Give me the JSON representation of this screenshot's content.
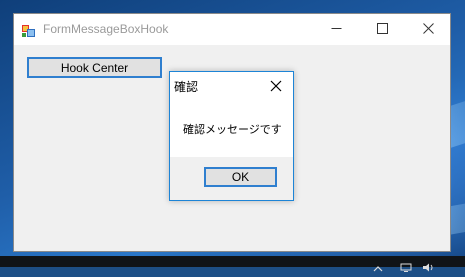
{
  "window": {
    "title": "FormMessageBoxHook"
  },
  "form": {
    "hook_button_label": "Hook Center"
  },
  "dialog": {
    "title": "確認",
    "message": "確認メッセージです",
    "ok_label": "OK"
  },
  "colors": {
    "accent_border": "#2f7fcf",
    "dialog_border": "#1d84d6",
    "window_bg": "#f0f0f0"
  },
  "icons": {
    "app": "winforms-app-icon",
    "minimize": "minimize-icon",
    "maximize": "maximize-icon",
    "close": "close-icon",
    "dialog_close": "close-icon"
  }
}
